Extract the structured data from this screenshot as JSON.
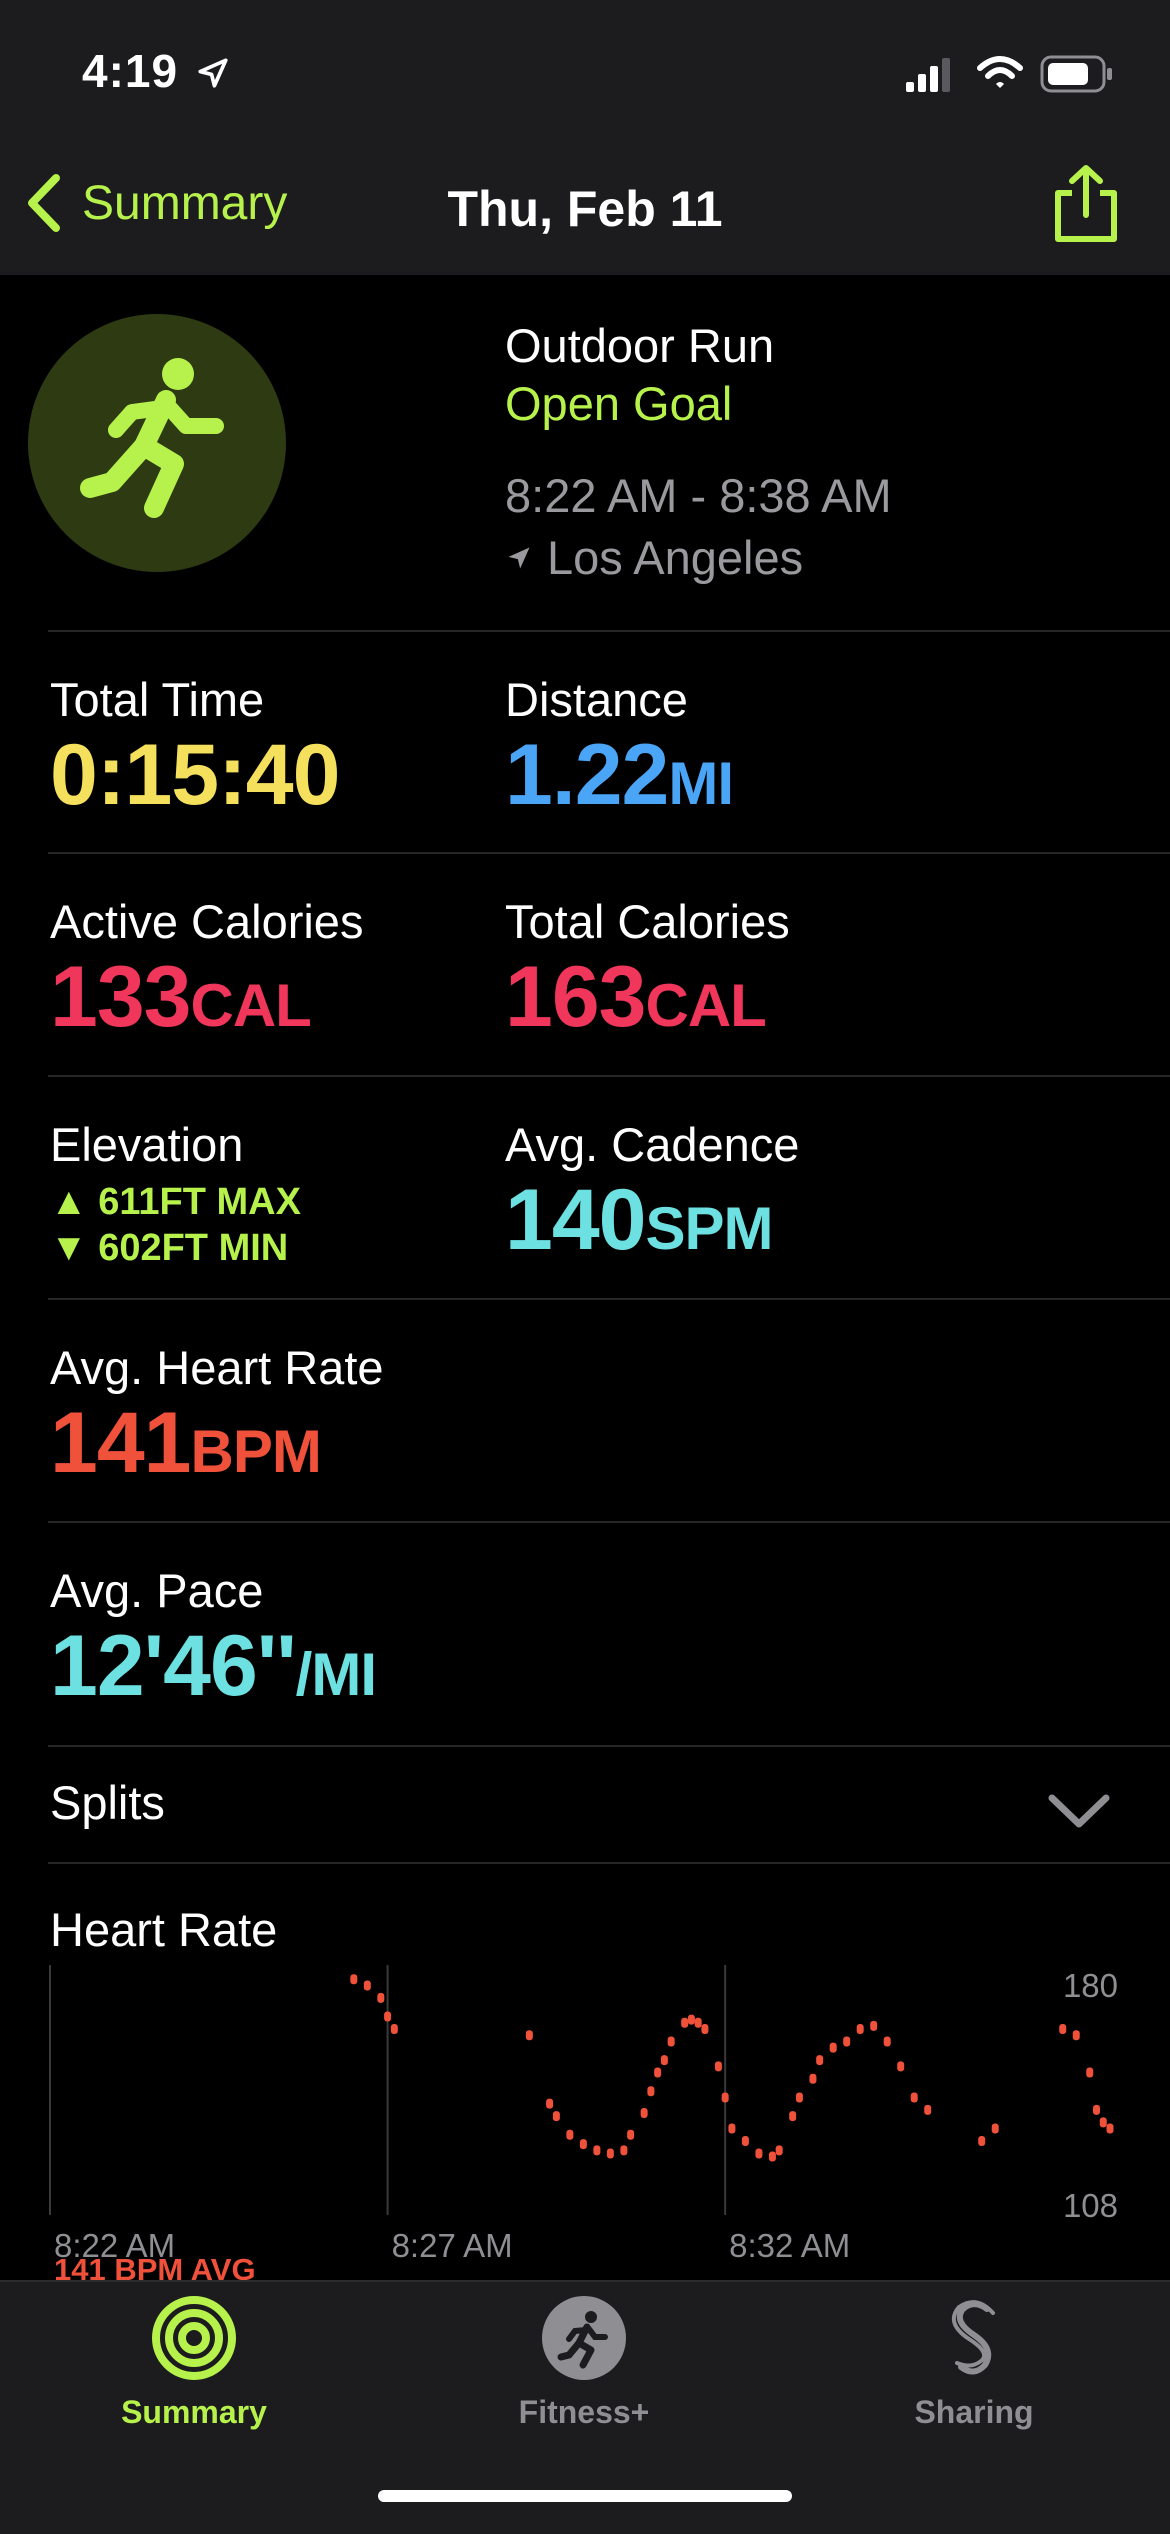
{
  "status_bar": {
    "time": "4:19"
  },
  "nav": {
    "back_label": "Summary",
    "title": "Thu, Feb 11"
  },
  "workout": {
    "type": "Outdoor Run",
    "goal": "Open Goal",
    "time_range": "8:22 AM - 8:38 AM",
    "location": "Los Angeles"
  },
  "metrics": {
    "total_time": {
      "label": "Total Time",
      "value": "0:15:40"
    },
    "distance": {
      "label": "Distance",
      "value": "1.22",
      "unit": "MI"
    },
    "active_calories": {
      "label": "Active Calories",
      "value": "133",
      "unit": "CAL"
    },
    "total_calories": {
      "label": "Total Calories",
      "value": "163",
      "unit": "CAL"
    },
    "elevation": {
      "label": "Elevation",
      "max": "611FT MAX",
      "min": "602FT MIN"
    },
    "avg_cadence": {
      "label": "Avg. Cadence",
      "value": "140",
      "unit": "SPM"
    },
    "avg_heart_rate": {
      "label": "Avg. Heart Rate",
      "value": "141",
      "unit": "BPM"
    },
    "avg_pace": {
      "label": "Avg. Pace",
      "value": "12'46''",
      "unit": "/MI"
    }
  },
  "splits": {
    "label": "Splits"
  },
  "heart_rate_section": {
    "title": "Heart Rate",
    "avg_label": "141 BPM AVG"
  },
  "chart_data": {
    "type": "scatter",
    "title": "Heart Rate",
    "ylim": [
      108,
      180
    ],
    "y_ticks": [
      "180",
      "108"
    ],
    "x_ticks": [
      "8:22 AM",
      "8:27 AM",
      "8:32 AM"
    ],
    "xlim_minutes": [
      0,
      15.7
    ],
    "series": [
      {
        "values": [
          [
            4.5,
            178
          ],
          [
            4.7,
            176
          ],
          [
            4.9,
            172
          ],
          [
            5.0,
            166
          ],
          [
            5.1,
            162
          ],
          [
            7.1,
            160
          ],
          [
            7.4,
            138
          ],
          [
            7.5,
            134
          ],
          [
            7.7,
            128
          ],
          [
            7.9,
            125
          ],
          [
            8.1,
            123
          ],
          [
            8.3,
            122
          ],
          [
            8.5,
            123
          ],
          [
            8.6,
            128
          ],
          [
            8.8,
            135
          ],
          [
            8.9,
            142
          ],
          [
            9.0,
            148
          ],
          [
            9.1,
            152
          ],
          [
            9.2,
            158
          ],
          [
            9.4,
            164
          ],
          [
            9.5,
            165
          ],
          [
            9.6,
            164
          ],
          [
            9.7,
            162
          ],
          [
            9.9,
            150
          ],
          [
            10.0,
            140
          ],
          [
            10.1,
            130
          ],
          [
            10.3,
            126
          ],
          [
            10.5,
            122
          ],
          [
            10.7,
            121
          ],
          [
            10.8,
            123
          ],
          [
            11.0,
            134
          ],
          [
            11.1,
            140
          ],
          [
            11.3,
            146
          ],
          [
            11.4,
            152
          ],
          [
            11.6,
            156
          ],
          [
            11.8,
            158
          ],
          [
            12.0,
            162
          ],
          [
            12.2,
            163
          ],
          [
            12.4,
            158
          ],
          [
            12.6,
            150
          ],
          [
            12.8,
            140
          ],
          [
            13.0,
            136
          ],
          [
            13.8,
            126
          ],
          [
            14.0,
            130
          ],
          [
            15.0,
            162
          ],
          [
            15.2,
            160
          ],
          [
            15.4,
            148
          ],
          [
            15.5,
            136
          ],
          [
            15.6,
            132
          ],
          [
            15.7,
            130
          ]
        ]
      }
    ]
  },
  "tabs": [
    {
      "label": "Summary",
      "active": true,
      "icon": "activity-rings-icon"
    },
    {
      "label": "Fitness+",
      "active": false,
      "icon": "running-figure-icon"
    },
    {
      "label": "Sharing",
      "active": false,
      "icon": "sharing-icon"
    }
  ],
  "colors": {
    "accent_green": "#b6f24b",
    "time_yellow": "#f4e05c",
    "distance_blue": "#4aa5f7",
    "calories_red": "#f0365a",
    "cadence_teal": "#6de0e1",
    "heart_orange": "#f0513a"
  }
}
